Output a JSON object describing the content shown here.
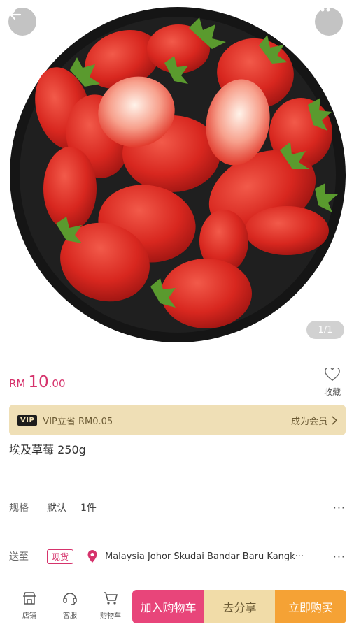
{
  "header": {
    "back_icon": "arrow-left-icon",
    "more_icon": "more-dots-icon",
    "pager": "1/1"
  },
  "product": {
    "price_currency": "RM",
    "price_integer": "10",
    "price_decimal": ".00",
    "title": "埃及草莓 250g",
    "image_desc": "strawberries-on-black-plate"
  },
  "favorite": {
    "label": "收藏",
    "icon": "heart-icon"
  },
  "vip": {
    "badge": "VIP",
    "text": "VIP立省 RM0.05",
    "join_label": "成为会员",
    "bg_color": "#efdfb6"
  },
  "spec": {
    "label": "规格",
    "value": "默认",
    "quantity": "1件",
    "more": "···"
  },
  "shipping": {
    "label": "送至",
    "stock_badge": "现货",
    "address": "Malaysia Johor Skudai Bandar Baru Kangk···",
    "more": "···"
  },
  "bottom": {
    "shop_label": "店铺",
    "service_label": "客服",
    "cart_label": "购物车",
    "add_to_cart": "加入购物车",
    "share": "去分享",
    "buy_now": "立即购买"
  },
  "colors": {
    "accent": "#d6336c",
    "add_cart_bg": "#e8457a",
    "share_bg": "#f1dca8",
    "buy_bg": "#f5a235"
  }
}
